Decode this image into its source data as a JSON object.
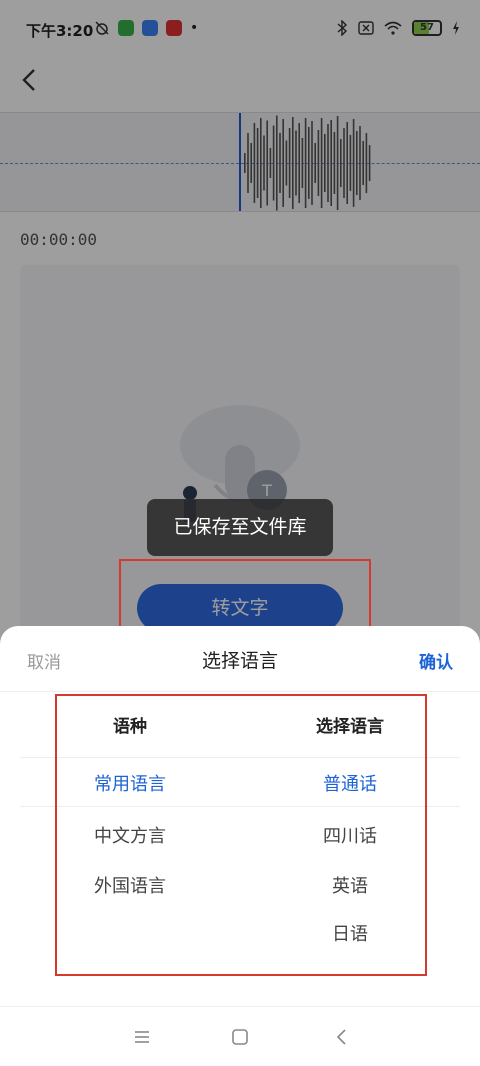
{
  "status_bar": {
    "time": "下午3:20",
    "battery": "57"
  },
  "recording": {
    "timestamp": "00:00:00",
    "convert_button_label": "转文字"
  },
  "toast": {
    "message": "已保存至文件库"
  },
  "sheet": {
    "cancel_label": "取消",
    "title": "选择语言",
    "confirm_label": "确认",
    "columns": {
      "left_header": "语种",
      "right_header": "选择语言"
    },
    "left_options": [
      "常用语言",
      "中文方言",
      "外国语言"
    ],
    "right_options": [
      "普通话",
      "四川话",
      "英语",
      "日语"
    ],
    "selected_left": "常用语言",
    "selected_right": "普通话"
  },
  "colors": {
    "accent": "#1d63d8",
    "annotation": "#d53a2f"
  }
}
